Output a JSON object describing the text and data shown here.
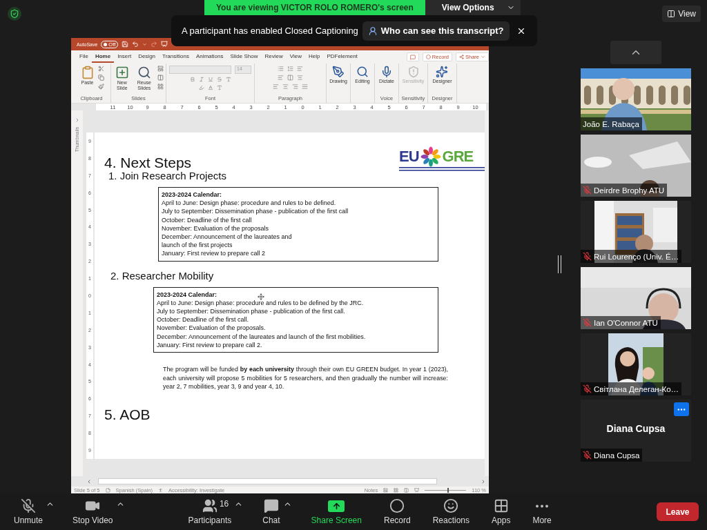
{
  "share_banner": {
    "text": "You are viewing VICTOR ROLO ROMERO's screen",
    "options_button": "View Options"
  },
  "view_button": "View",
  "caption_toast": {
    "message": "A participant has enabled Closed Captioning",
    "link": "Who can see this transcript?"
  },
  "powerpoint": {
    "autosave": {
      "label": "AutoSave",
      "on": false,
      "state_text": "Off"
    },
    "menu_tabs": [
      {
        "label": "File",
        "selected": false
      },
      {
        "label": "Home",
        "selected": true
      },
      {
        "label": "Insert",
        "selected": false
      },
      {
        "label": "Design",
        "selected": false
      },
      {
        "label": "Transitions",
        "selected": false
      },
      {
        "label": "Animations",
        "selected": false
      },
      {
        "label": "Slide Show",
        "selected": false
      },
      {
        "label": "Review",
        "selected": false
      },
      {
        "label": "View",
        "selected": false
      },
      {
        "label": "Help",
        "selected": false
      },
      {
        "label": "PDFelement",
        "selected": false
      }
    ],
    "record_button": "Record",
    "share_button": "Share",
    "ribbon_groups": [
      {
        "title": "Clipboard",
        "kind": "clipboard",
        "buttons": [
          {
            "label": "Paste",
            "disabled": false
          }
        ]
      },
      {
        "title": "Slides",
        "kind": "slides",
        "buttons": [
          {
            "label": "New Slide",
            "disabled": false
          },
          {
            "label": "Reuse Slides",
            "disabled": false
          }
        ]
      },
      {
        "title": "Font",
        "kind": "font",
        "font_size": "14"
      },
      {
        "title": "Paragraph",
        "kind": "paragraph"
      },
      {
        "kind": "single",
        "buttons": [
          {
            "label": "Drawing",
            "disabled": false
          }
        ]
      },
      {
        "kind": "single",
        "buttons": [
          {
            "label": "Editing",
            "disabled": false
          }
        ]
      },
      {
        "title": "Voice",
        "kind": "single",
        "buttons": [
          {
            "label": "Dictate",
            "disabled": false
          }
        ]
      },
      {
        "title": "Sensitivity",
        "kind": "single",
        "buttons": [
          {
            "label": "Sensitivity",
            "disabled": true
          }
        ]
      },
      {
        "title": "Designer",
        "kind": "single",
        "buttons": [
          {
            "label": "Designer",
            "disabled": false
          }
        ]
      }
    ],
    "ruler_marks": [
      "11",
      "10",
      "9",
      "8",
      "7",
      "6",
      "5",
      "4",
      "3",
      "2",
      "1",
      "0",
      "1",
      "2",
      "3",
      "4",
      "5",
      "6",
      "7",
      "8",
      "9",
      "10"
    ],
    "vertical_ruler_marks": [
      "9",
      "8",
      "7",
      "6",
      "5",
      "4",
      "3",
      "2",
      "1",
      "0",
      "1",
      "2",
      "3",
      "4",
      "5",
      "6",
      "7",
      "8",
      "9"
    ],
    "thumbnails_label": "Thumbnails",
    "slide": {
      "title": "4. Next Steps",
      "logo": {
        "left": "EU",
        "right": "GRE"
      },
      "sections": [
        {
          "heading": "1. Join Research Projects",
          "calendar": {
            "title": "2023-2024 Calendar:",
            "lines": [
              "April to June: Design phase: procedure and rules to be defined.",
              "July to September: Dissemination phase - publication of the first call",
              "October: Deadline of the first call",
              "November: Evaluation of the proposals",
              "December: Announcement of the laureates and",
              "launch of the first projects",
              "January: First review to prepare call 2"
            ]
          }
        },
        {
          "heading": "2. Researcher Mobility",
          "calendar": {
            "title": "2023-2024 Calendar:",
            "lines": [
              "April to June: Design phase: procedure and rules to be defined by the JRC.",
              "July to September: Dissemination phase - publication of the first call.",
              "October: Deadline of the first call.",
              "November: Evaluation of the proposals.",
              "December: Announcement of the laureates and launch of the first mobilities.",
              "January: First review to prepare call 2."
            ]
          },
          "note": "The program will be funded **by each university** through their own EU GREEN budget. In year 1 (2023), each university will propose 5 mobilities for 5 researchers, and then gradually the number will increase: year 2, 7 mobilities, year 3, 9 and year 4, 10."
        }
      ],
      "closing_title": "5. AOB"
    },
    "status_bar": {
      "slide": "Slide 5 of 5",
      "language": "Spanish (Spain)",
      "accessibility": "Accessibility: Investigate",
      "notes": "Notes",
      "zoom": "110 %",
      "zoom_slider": {
        "level": 0.55
      }
    }
  },
  "participants": [
    {
      "name": "João E. Rabaça",
      "kind": "video",
      "muted": false
    },
    {
      "name": "Deirdre Brophy ATU",
      "kind": "video",
      "muted": true
    },
    {
      "name": "Rui Lourenço (Univ. É…",
      "kind": "inset",
      "muted": true
    },
    {
      "name": "Ian O'Connor ATU",
      "kind": "video",
      "muted": true
    },
    {
      "name": "Світлана Делеган-Ко…",
      "kind": "inset_small",
      "muted": true
    },
    {
      "name": "Diana Cupsa",
      "kind": "no_video",
      "display_name": "Diana Cupsa",
      "muted": true
    }
  ],
  "toolbar": [
    {
      "label": "Unmute",
      "muted": true,
      "menu": true
    },
    {
      "label": "Stop Video",
      "menu": true
    },
    {
      "label": "Participants",
      "count": "16",
      "menu": true
    },
    {
      "label": "Chat",
      "menu": true
    },
    {
      "label": "Share Screen",
      "highlight": true
    },
    {
      "label": "Record"
    },
    {
      "label": "Reactions"
    },
    {
      "label": "Apps"
    },
    {
      "label": "More"
    }
  ],
  "leave_button": "Leave"
}
